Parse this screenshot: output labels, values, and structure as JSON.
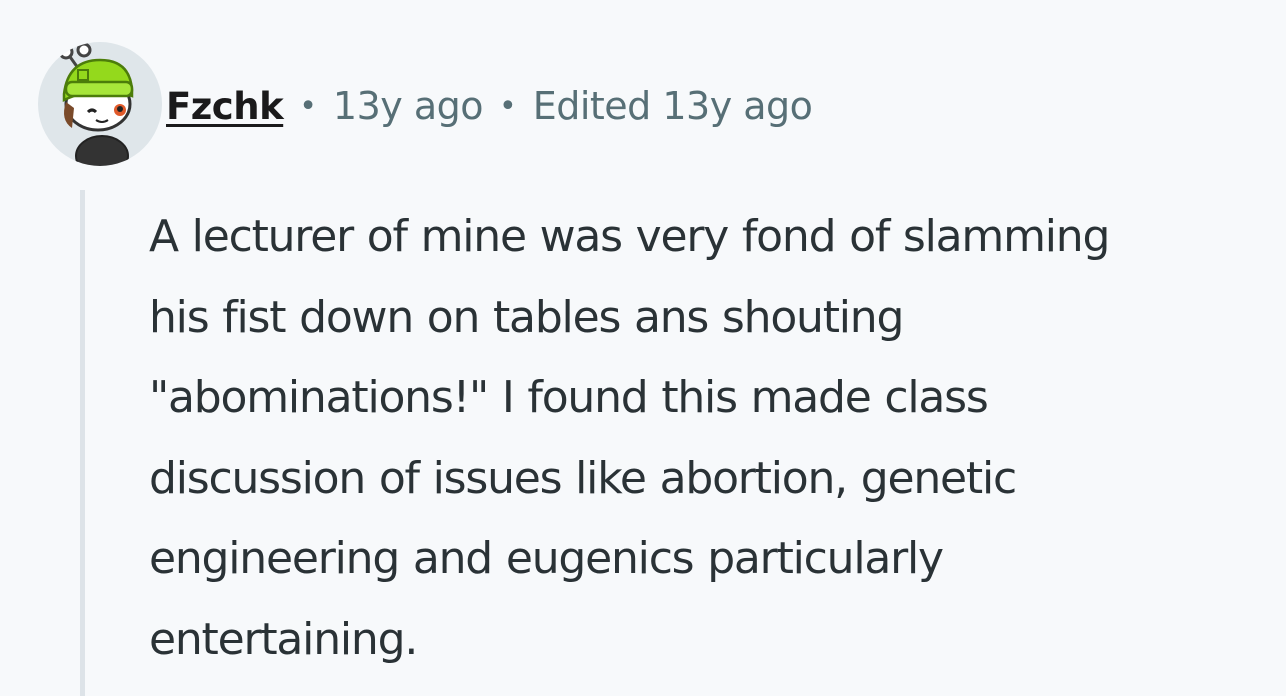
{
  "comment": {
    "author": "Fzchk",
    "separator": "•",
    "posted": "13y ago",
    "edited": "Edited 13y ago",
    "body_lines": [
      "A lecturer of mine was very fond of slamming",
      "his fist down on tables ans shouting",
      "\"abominations!\" I found this made class",
      "discussion of issues like abortion, genetic",
      "engineering and eugenics particularly",
      "entertaining."
    ]
  },
  "colors": {
    "background": "#f7f9fb",
    "text": "#2a3236",
    "meta": "#576f76",
    "thread_line": "#dde3e8",
    "beanie": "#94d91c"
  },
  "icons": {
    "avatar": "snoo-avatar-icon"
  }
}
